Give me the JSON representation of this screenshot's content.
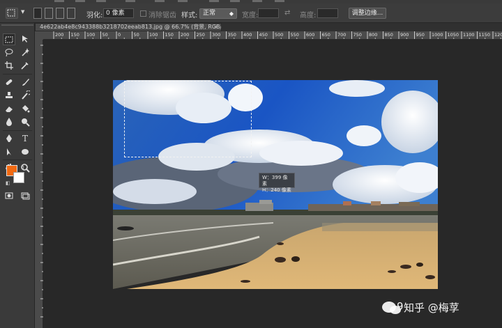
{
  "options_bar": {
    "feather_label": "羽化:",
    "feather_value": "0 像素",
    "antialias_label": "消除锯齿",
    "style_label": "样式:",
    "style_value": "正常",
    "width_label": "宽度:",
    "height_label": "高度:",
    "refine_edge_button": "调整边缘..."
  },
  "document": {
    "tab_title": "4e622ab4e8c943388b3218702eeab813.jpg @ 66.7% (背景, RGB/8#) *",
    "close_glyph": "×"
  },
  "ruler": {
    "h_labels": [
      "200",
      "150",
      "100",
      "50",
      "0",
      "50",
      "100",
      "150",
      "200",
      "250",
      "300",
      "350",
      "400",
      "450",
      "500",
      "550",
      "600",
      "650",
      "700",
      "750",
      "800",
      "850",
      "900",
      "950",
      "1000",
      "1050",
      "1100",
      "1150",
      "1200"
    ]
  },
  "measure_tooltip": {
    "width_line": "W：399 像素",
    "height_line": "H：240 像素"
  },
  "watermark": {
    "text": "知乎 @梅莩",
    "partial_digit": "9"
  },
  "colors": {
    "foreground": "#f26a12",
    "background": "#ffffff",
    "sky": "#1d5fbf",
    "accent": "#ffffff"
  }
}
